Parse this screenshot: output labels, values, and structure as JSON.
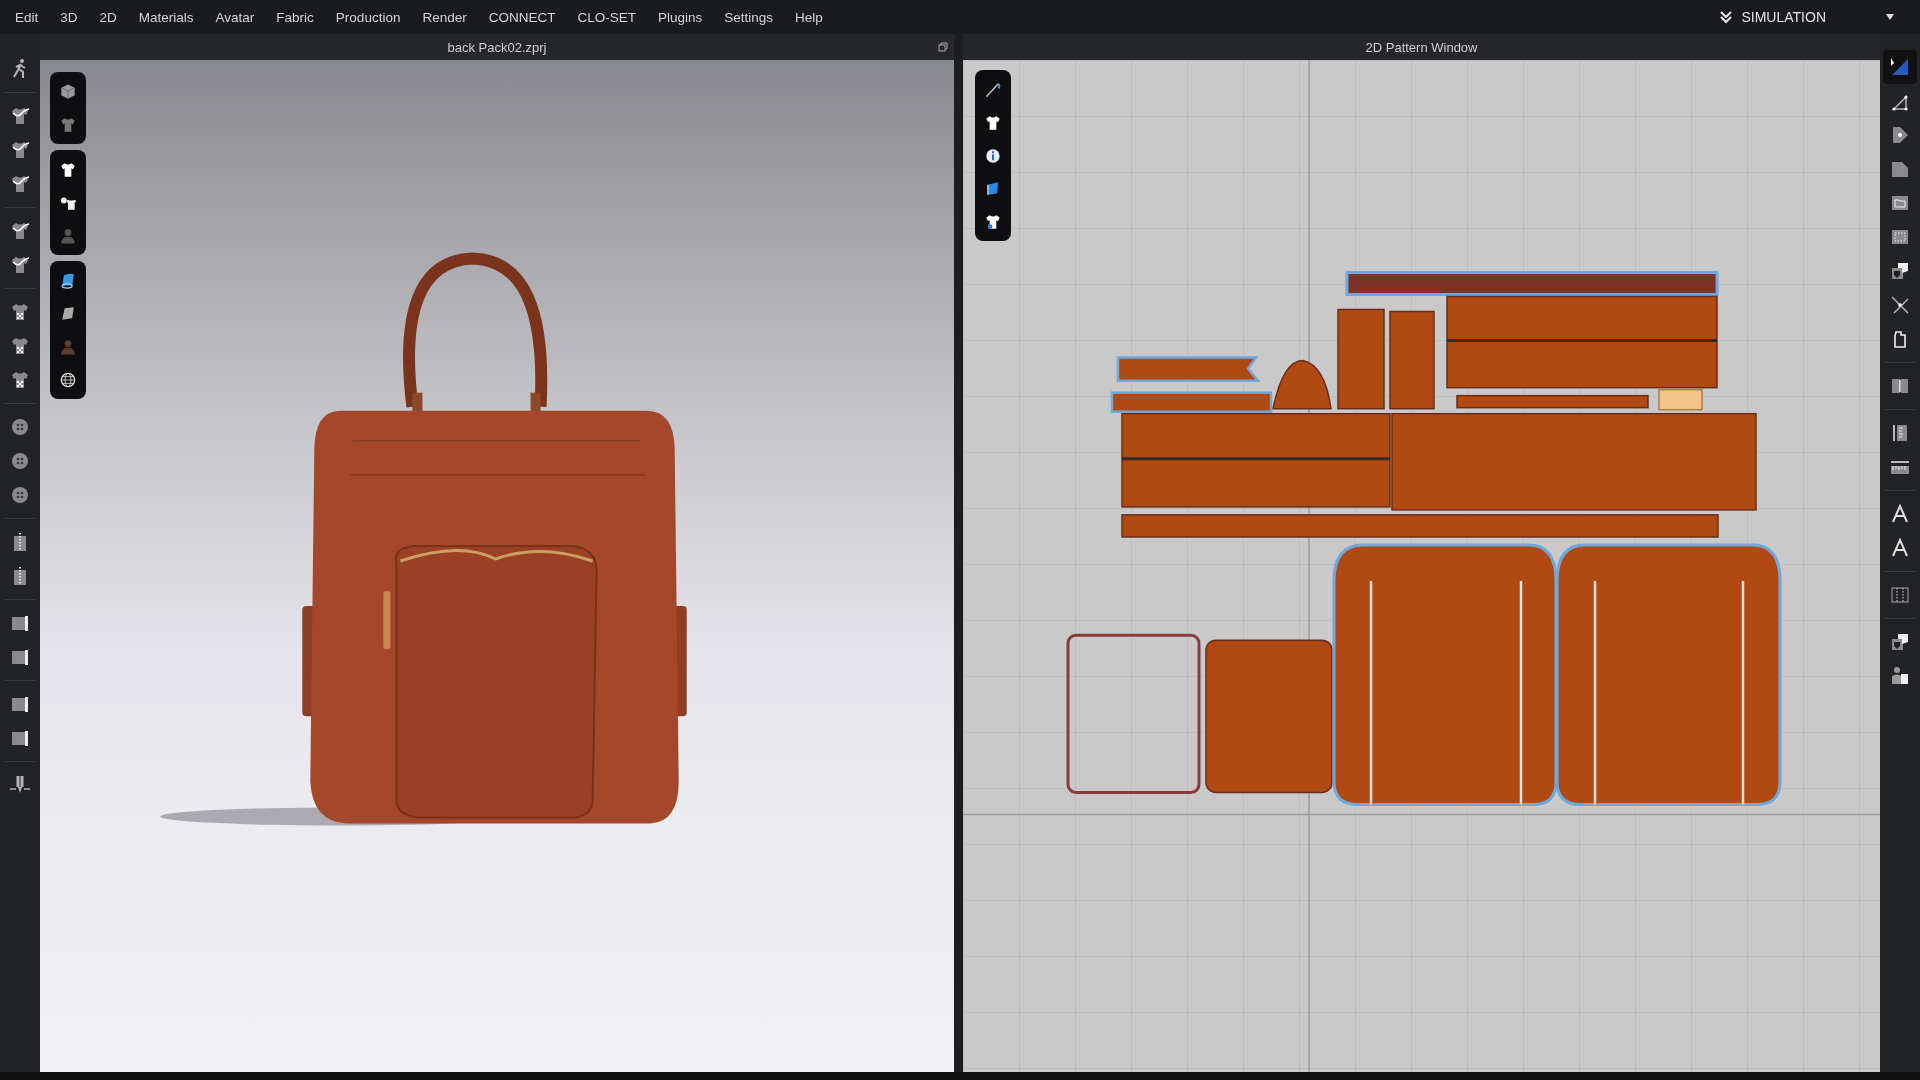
{
  "menu": [
    "Edit",
    "3D",
    "2D",
    "Materials",
    "Avatar",
    "Fabric",
    "Production",
    "Render",
    "CONNECT",
    "CLO-SET",
    "Plugins",
    "Settings",
    "Help"
  ],
  "mode_switch": {
    "label": "SIMULATION"
  },
  "viewport_3d": {
    "title": "back Pack02.zprj"
  },
  "pattern_window": {
    "title": "2D Pattern Window"
  },
  "right_toolbar": [
    {
      "selected": true
    },
    {
      "selected": false
    },
    {
      "selected": false
    },
    {
      "selected": false
    },
    {
      "selected": false
    },
    {
      "selected": false
    },
    {
      "selected": false
    },
    {
      "selected": false
    },
    {
      "selected": false
    },
    {
      "selected": false
    },
    {
      "selected": false
    },
    {
      "selected": false
    },
    {
      "selected": false
    },
    {
      "selected": false
    },
    {
      "selected": false
    },
    {
      "selected": false
    },
    {
      "selected": false
    }
  ]
}
